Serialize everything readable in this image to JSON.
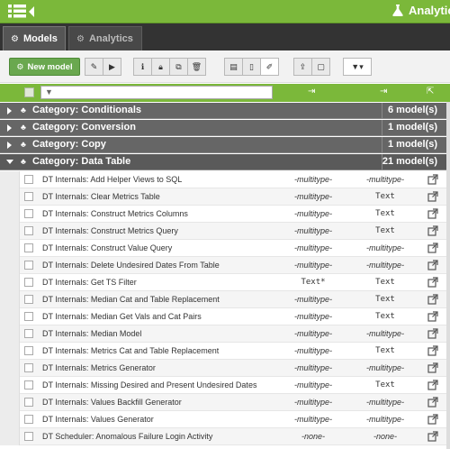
{
  "topbar": {
    "title": "Analytic",
    "menu_icon": "hamburger-icon",
    "back_icon": "caret-left-icon",
    "flask_icon": "flask-icon",
    "color": "#7bb83a"
  },
  "tabs": [
    {
      "label": "Models",
      "icon": "cogs-icon",
      "active": true
    },
    {
      "label": "Analytics",
      "icon": "cog-icon",
      "active": false
    }
  ],
  "toolbar": {
    "new_label": "New model",
    "buttons": [
      "edit-icon",
      "play-icon",
      "info-icon",
      "lock-icon",
      "copy-icon",
      "trash-icon",
      "table-icon",
      "document-icon",
      "pencil-icon",
      "export-icon",
      "stop-icon",
      "filter-icon"
    ]
  },
  "grid": {
    "search_placeholder": "",
    "categories": [
      {
        "label": "Category: Conditionals",
        "count": "6 model(s)",
        "expanded": false
      },
      {
        "label": "Category: Conversion",
        "count": "1 model(s)",
        "expanded": false
      },
      {
        "label": "Category: Copy",
        "count": "1 model(s)",
        "expanded": false
      },
      {
        "label": "Category: Data Table",
        "count": "21 model(s)",
        "expanded": true
      }
    ],
    "rows": [
      {
        "name": "DT Internals: Add Helper Views to SQL",
        "input": "-multitype-",
        "output": "-multitype-"
      },
      {
        "name": "DT Internals: Clear Metrics Table",
        "input": "-multitype-",
        "output": "Text"
      },
      {
        "name": "DT Internals: Construct Metrics Columns",
        "input": "-multitype-",
        "output": "Text"
      },
      {
        "name": "DT Internals: Construct Metrics Query",
        "input": "-multitype-",
        "output": "Text"
      },
      {
        "name": "DT Internals: Construct Value Query",
        "input": "-multitype-",
        "output": "-multitype-"
      },
      {
        "name": "DT Internals: Delete Undesired Dates From Table",
        "input": "-multitype-",
        "output": "-multitype-"
      },
      {
        "name": "DT Internals: Get TS Filter",
        "input": "Text*",
        "output": "Text"
      },
      {
        "name": "DT Internals: Median Cat and Table Replacement",
        "input": "-multitype-",
        "output": "Text"
      },
      {
        "name": "DT Internals: Median Get Vals and Cat Pairs",
        "input": "-multitype-",
        "output": "Text"
      },
      {
        "name": "DT Internals: Median Model",
        "input": "-multitype-",
        "output": "-multitype-"
      },
      {
        "name": "DT Internals: Metrics Cat and Table Replacement",
        "input": "-multitype-",
        "output": "Text"
      },
      {
        "name": "DT Internals: Metrics Generator",
        "input": "-multitype-",
        "output": "-multitype-"
      },
      {
        "name": "DT Internals: Missing Desired and Present Undesired Dates",
        "input": "-multitype-",
        "output": "Text"
      },
      {
        "name": "DT Internals: Values Backfill Generator",
        "input": "-multitype-",
        "output": "-multitype-"
      },
      {
        "name": "DT Internals: Values Generator",
        "input": "-multitype-",
        "output": "-multitype-"
      },
      {
        "name": "DT Scheduler: Anomalous Failure Login Activity",
        "input": "-none-",
        "output": "-none-"
      }
    ]
  }
}
